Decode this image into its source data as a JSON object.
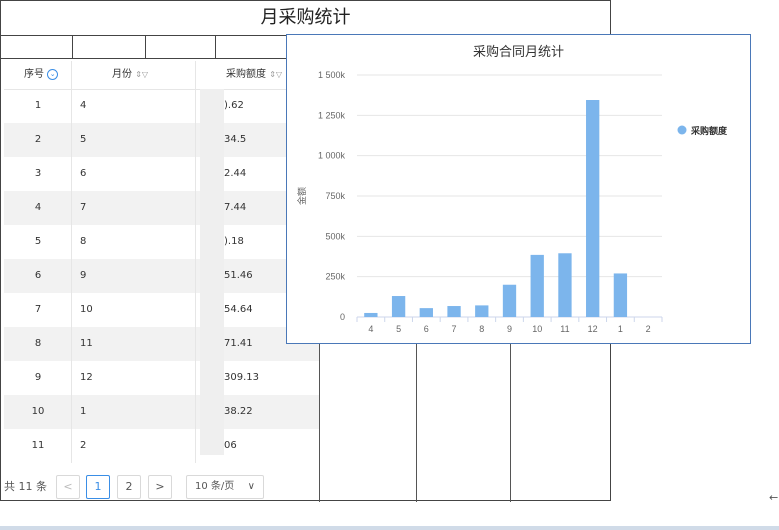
{
  "report": {
    "title": "月采购统计"
  },
  "table": {
    "headers": {
      "index": "序号",
      "month": "月份",
      "amount": "采购额度"
    },
    "rows": [
      {
        "idx": "1",
        "month": "4",
        "amount": ").62"
      },
      {
        "idx": "2",
        "month": "5",
        "amount": "34.5"
      },
      {
        "idx": "3",
        "month": "6",
        "amount": "2.44"
      },
      {
        "idx": "4",
        "month": "7",
        "amount": "7.44"
      },
      {
        "idx": "5",
        "month": "8",
        "amount": ").18"
      },
      {
        "idx": "6",
        "month": "9",
        "amount": "51.46"
      },
      {
        "idx": "7",
        "month": "10",
        "amount": "54.64"
      },
      {
        "idx": "8",
        "month": "11",
        "amount": "71.41"
      },
      {
        "idx": "9",
        "month": "12",
        "amount": "309.13"
      },
      {
        "idx": "10",
        "month": "1",
        "amount": "38.22"
      },
      {
        "idx": "11",
        "month": "2",
        "amount": "06"
      }
    ]
  },
  "pager": {
    "total": "共 11 条",
    "prev": "<",
    "page1": "1",
    "page2": "2",
    "next": ">",
    "size": "10 条/页",
    "size_caret": "∨"
  },
  "nav": {
    "back": "←"
  },
  "icons": {
    "sort": "sort-icon",
    "filter": "filter-icon",
    "index_badge": "circle-chevron-icon"
  },
  "colors": {
    "bar": "#7cb5ec",
    "accent": "#3a8ee6"
  },
  "chart_data": {
    "type": "bar",
    "title": "采购合同月统计",
    "xlabel": "",
    "ylabel": "金额",
    "categories": [
      "4",
      "5",
      "6",
      "7",
      "8",
      "9",
      "10",
      "11",
      "12",
      "1",
      "2"
    ],
    "series": [
      {
        "name": "采购额度",
        "values": [
          25000,
          130000,
          55000,
          68000,
          72000,
          200000,
          385000,
          395000,
          1345000,
          270000,
          0
        ]
      }
    ],
    "ylim": [
      0,
      1500000
    ],
    "yticks": [
      0,
      250000,
      500000,
      750000,
      1000000,
      1250000,
      1500000
    ],
    "ytick_labels": [
      "0",
      "250k",
      "500k",
      "750k",
      "1 000k",
      "1 250k",
      "1 500k"
    ],
    "grid": true,
    "legend": "right"
  }
}
